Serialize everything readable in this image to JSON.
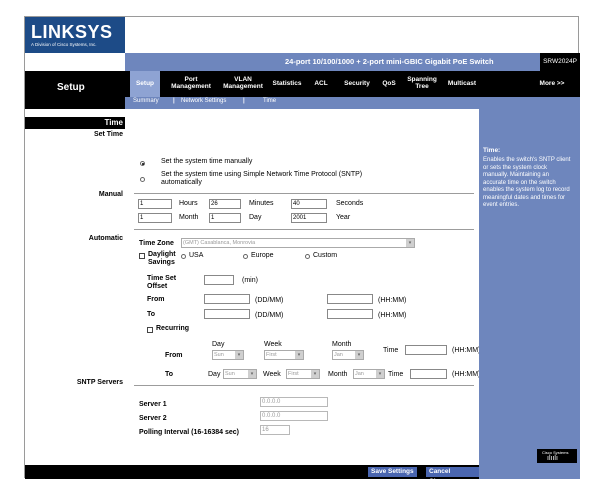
{
  "brand": {
    "logo": "LINKSYS",
    "sub": "A Division of Cisco Systems, Inc."
  },
  "header": {
    "product_title": "24-port 10/100/1000 + 2-port mini-GBIC Gigabit PoE Switch",
    "model": "SRW2024P",
    "section": "Setup"
  },
  "nav": {
    "tabs": [
      {
        "label": "Setup"
      },
      {
        "label": "Port Management"
      },
      {
        "label": "VLAN Management"
      },
      {
        "label": "Statistics"
      },
      {
        "label": "ACL"
      },
      {
        "label": "Security"
      },
      {
        "label": "QoS"
      },
      {
        "label": "Spanning Tree"
      },
      {
        "label": "Multicast"
      },
      {
        "label": "More >>"
      }
    ],
    "sub": [
      {
        "label": "Summary"
      },
      {
        "label": "Network Settings"
      },
      {
        "label": "Time"
      }
    ]
  },
  "left_labels": {
    "time": "Time",
    "set_time": "Set Time",
    "manual": "Manual",
    "automatic": "Automatic",
    "sntp_servers": "SNTP Servers"
  },
  "set_time": {
    "opt_manual": "Set the system time manually",
    "opt_sntp": "Set the system time using Simple Network Time Protocol (SNTP) automatically"
  },
  "manual": {
    "hours_value": "1",
    "hours_label": "Hours",
    "minutes_value": "26",
    "minutes_label": "Minutes",
    "seconds_value": "40",
    "seconds_label": "Seconds",
    "day_value": "1",
    "month_label": "Month",
    "month_value": "1",
    "day_label": "Day",
    "year_value": "2001",
    "year_label": "Year"
  },
  "automatic": {
    "timezone_label": "Time Zone",
    "timezone_value": "(GMT) Casablanca, Monrovia",
    "daylight_label": "Daylight Savings",
    "usa": "USA",
    "europe": "Europe",
    "custom": "Custom",
    "time_set_offset": "Time Set Offset",
    "min_label": "(min)",
    "from_label": "From",
    "to_label": "To",
    "ddmm": "(DD/MM)",
    "hhmm": "(HH:MM)",
    "recurring": "Recurring",
    "day_label": "Day",
    "week_label": "Week",
    "month_label": "Month",
    "time_label": "Time",
    "from_day": "Sun",
    "from_week": "First",
    "from_month": "Jan",
    "to_day": "Sun",
    "to_week": "First",
    "to_month": "Jan"
  },
  "sntp": {
    "server1_label": "Server 1",
    "server1_value": "0.0.0.0",
    "server2_label": "Server 2",
    "server2_value": "0.0.0.0",
    "poll_label": "Polling Interval (16-16384 sec)",
    "poll_value": "16"
  },
  "help": {
    "title": "Time:",
    "text": "Enables the switch's SNTP client or sets the system clock manually. Maintaining an accurate time on the switch enables the system log to record meaningful dates and times for event entries."
  },
  "buttons": {
    "save": "Save Settings",
    "cancel": "Cancel Changes"
  },
  "footer": {
    "cisco": "Cisco Systems"
  }
}
